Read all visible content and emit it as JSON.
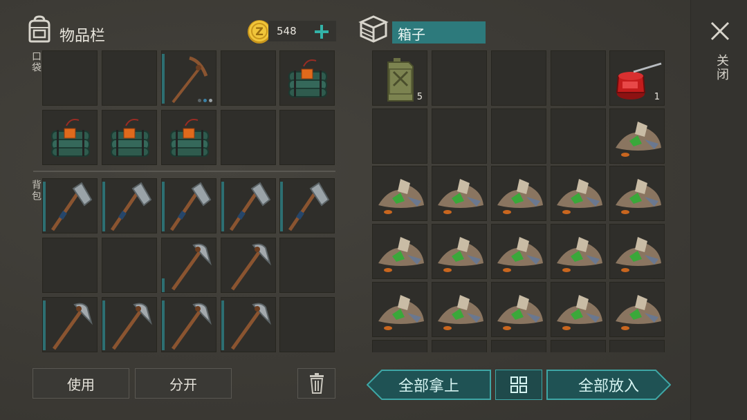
{
  "inventory": {
    "title": "物品栏",
    "coins": "548",
    "pocket_label": "口袋",
    "backpack_label": "背包"
  },
  "container": {
    "title": "箱子",
    "fuel_qty": "5",
    "oil_qty": "1"
  },
  "close_label": "关闭",
  "buttons": {
    "use": "使用",
    "split": "分开",
    "take_all": "全部拿上",
    "put_all": "全部放入"
  },
  "icons": {
    "backpack": "backpack-icon",
    "coin": "coin-icon",
    "plus": "plus-icon",
    "crate": "crate-icon",
    "close": "close-icon",
    "trash": "trash-icon",
    "sort": "sort-icon"
  },
  "colors": {
    "teal": "#2d7a7c",
    "teal_dark": "#1f5254",
    "coin": "#e0b428"
  }
}
